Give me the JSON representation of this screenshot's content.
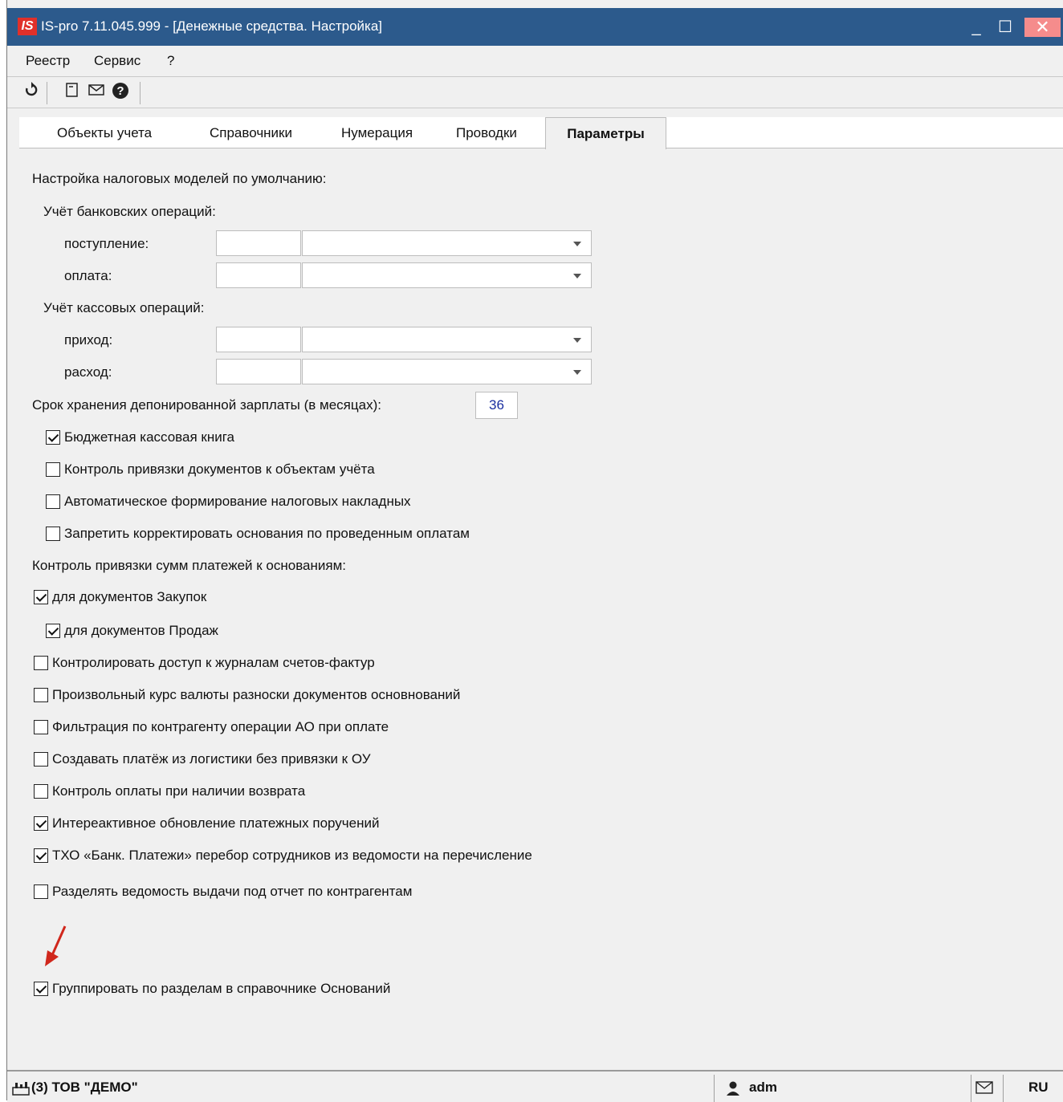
{
  "window": {
    "title": "IS-pro 7.11.045.999 - [Денежные средства. Настройка]",
    "logo": "IS",
    "minimize": "_",
    "maximize": "☐",
    "close": "✕"
  },
  "menu": [
    "Реестр",
    "Сервис",
    "?"
  ],
  "toolbar": {
    "icons": [
      "refresh-icon",
      "document-icon",
      "mail-icon",
      "help-icon"
    ]
  },
  "tabs": {
    "items": [
      "Объекты учета",
      "Справочники",
      "Нумерация",
      "Проводки"
    ],
    "active": "Параметры"
  },
  "form": {
    "heading_tax": "Настройка налоговых моделей по умолчанию:",
    "bank_heading": "Учёт банковских операций:",
    "bank_in": "поступление:",
    "bank_out": "оплата:",
    "cash_heading": "Учёт кассовых операций:",
    "cash_in": "приход:",
    "cash_out": "расход:",
    "deposit_label": "Срок хранения депонированной зарплаты (в месяцах):",
    "deposit_value": "36",
    "cb_budget": "Бюджетная кассовая книга",
    "cb_control_binding": "Контроль привязки документов к объектам учёта",
    "cb_auto_tax": "Автоматическое формирование налоговых накладных",
    "cb_forbid_edit": "Запретить  корректировать основания по проведенным оплатам",
    "heading_control": "Контроль привязки сумм платежей к основаниям:",
    "cb_purchases": "для документов Закупок",
    "cb_sales": "для документов Продаж",
    "cb_invoice_journals": "Контролировать доступ к журналам счетов-фактур",
    "cb_arbitrary_rate": "Произвольный курс валюты разноски  документов основнований",
    "cb_filter_ao": "Фильтрация по контрагенту операции АО при оплате",
    "cb_logistics": "Создавать платёж из логистики без привязки к ОУ",
    "cb_return": "Контроль оплаты  при наличии возврата",
    "cb_interactive": "Интереактивное обновление платежных поручений",
    "cb_txo": "ТХО «Банк. Платежи»  перебор сотрудников из ведомости на перечисление",
    "cb_split": "Разделять ведомость выдачи под отчет по контрагентам",
    "cb_group": "Группировать по разделам в справочнике Оснований"
  },
  "checked": {
    "cb_budget": true,
    "cb_control_binding": false,
    "cb_auto_tax": false,
    "cb_forbid_edit": false,
    "cb_purchases": true,
    "cb_sales": true,
    "cb_invoice_journals": false,
    "cb_arbitrary_rate": false,
    "cb_filter_ao": false,
    "cb_logistics": false,
    "cb_return": false,
    "cb_interactive": true,
    "cb_txo": true,
    "cb_split": false,
    "cb_group": true
  },
  "status": {
    "company": "(3) ТОВ \"ДЕМО\"",
    "user": "adm",
    "lang": "RU",
    "icons": [
      "factory-icon",
      "user-icon",
      "mail-icon"
    ]
  },
  "colors": {
    "titlebar": "#2c5a8c",
    "close_button": "#f58c8c",
    "logo": "#e0302a",
    "arrow": "#d0271c",
    "number_text": "#1a2ea0"
  }
}
